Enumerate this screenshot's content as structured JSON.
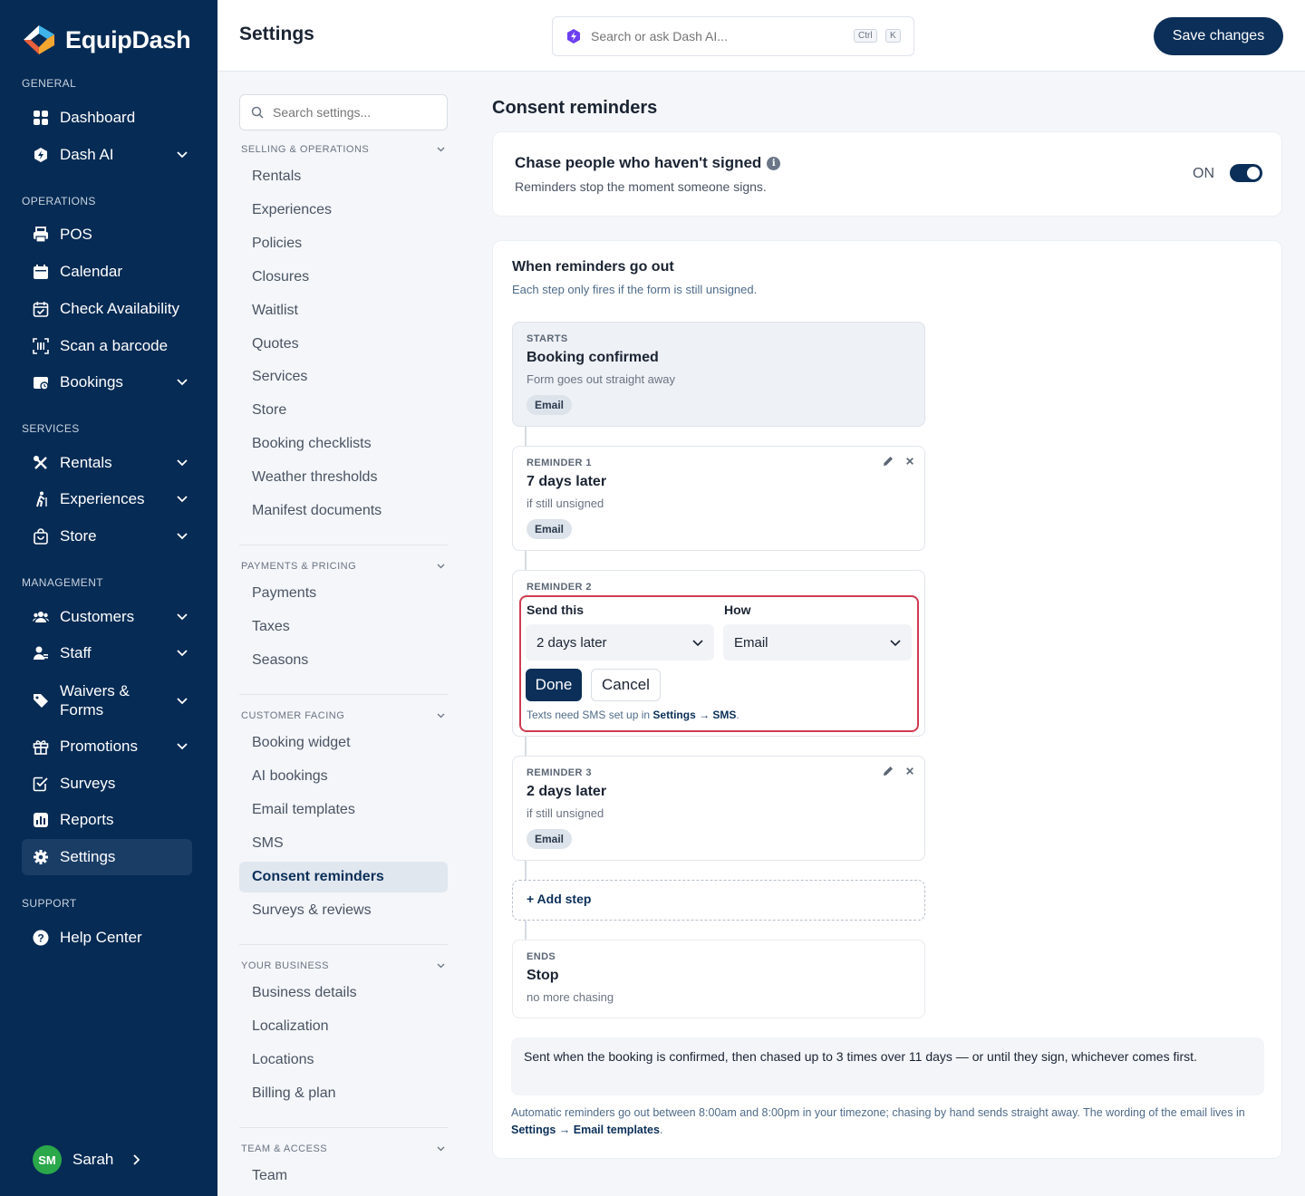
{
  "brand": {
    "name": "EquipDash",
    "accent": "#062b54"
  },
  "nav": {
    "sections": [
      {
        "label": "GENERAL",
        "items": [
          {
            "label": "Dashboard",
            "icon": "grid-icon",
            "chevron": false
          },
          {
            "label": "Dash AI",
            "icon": "sparkle-icon",
            "chevron": true
          }
        ]
      },
      {
        "label": "OPERATIONS",
        "items": [
          {
            "label": "POS",
            "icon": "printer-icon",
            "chevron": false
          },
          {
            "label": "Calendar",
            "icon": "calendar-icon",
            "chevron": false
          },
          {
            "label": "Check Availability",
            "icon": "calendar-check-icon",
            "chevron": false
          },
          {
            "label": "Scan a barcode",
            "icon": "barcode-icon",
            "chevron": false
          },
          {
            "label": "Bookings",
            "icon": "bookings-icon",
            "chevron": true
          }
        ]
      },
      {
        "label": "SERVICES",
        "items": [
          {
            "label": "Rentals",
            "icon": "tools-icon",
            "chevron": true
          },
          {
            "label": "Experiences",
            "icon": "hiker-icon",
            "chevron": true
          },
          {
            "label": "Store",
            "icon": "bag-icon",
            "chevron": true
          }
        ]
      },
      {
        "label": "MANAGEMENT",
        "items": [
          {
            "label": "Customers",
            "icon": "users-icon",
            "chevron": true
          },
          {
            "label": "Staff",
            "icon": "staff-icon",
            "chevron": true
          },
          {
            "label": "Waivers & Forms",
            "icon": "tag-icon",
            "chevron": true
          },
          {
            "label": "Promotions",
            "icon": "gift-icon",
            "chevron": true
          },
          {
            "label": "Surveys",
            "icon": "checkbox-icon",
            "chevron": false
          },
          {
            "label": "Reports",
            "icon": "chart-icon",
            "chevron": false
          },
          {
            "label": "Settings",
            "icon": "gear-icon",
            "chevron": false,
            "active": true
          }
        ]
      },
      {
        "label": "SUPPORT",
        "items": [
          {
            "label": "Help Center",
            "icon": "help-icon",
            "chevron": false
          }
        ]
      }
    ],
    "user": {
      "initials": "SM",
      "name": "Sarah"
    }
  },
  "header": {
    "title": "Settings",
    "search_placeholder": "Search or ask Dash AI...",
    "kbd_ctrl": "Ctrl",
    "kbd_k": "K",
    "save_label": "Save changes"
  },
  "subnav": {
    "search_placeholder": "Search settings...",
    "groups": [
      {
        "label": "SELLING & OPERATIONS",
        "items": [
          "Rentals",
          "Experiences",
          "Policies",
          "Closures",
          "Waitlist",
          "Quotes",
          "Services",
          "Store",
          "Booking checklists",
          "Weather thresholds",
          "Manifest documents"
        ]
      },
      {
        "label": "PAYMENTS & PRICING",
        "items": [
          "Payments",
          "Taxes",
          "Seasons"
        ]
      },
      {
        "label": "CUSTOMER FACING",
        "items": [
          "Booking widget",
          "AI bookings",
          "Email templates",
          "SMS",
          "Consent reminders",
          "Surveys & reviews"
        ],
        "active": "Consent reminders"
      },
      {
        "label": "YOUR BUSINESS",
        "items": [
          "Business details",
          "Localization",
          "Locations",
          "Billing & plan"
        ]
      },
      {
        "label": "TEAM & ACCESS",
        "items": [
          "Team"
        ]
      }
    ]
  },
  "main": {
    "section_title": "Consent reminders",
    "chase": {
      "title": "Chase people who haven't signed",
      "subtitle": "Reminders stop the moment someone signs.",
      "toggle_label": "ON",
      "toggle_on": true
    },
    "when": {
      "title": "When reminders go out",
      "subtitle": "Each step only fires if the form is still unsigned."
    },
    "steps": {
      "start": {
        "kicker": "STARTS",
        "title": "Booking confirmed",
        "desc": "Form goes out straight away",
        "chip": "Email"
      },
      "r1": {
        "kicker": "REMINDER 1",
        "title": "7 days later",
        "desc": "if still unsigned",
        "chip": "Email"
      },
      "r2": {
        "kicker": "REMINDER 2",
        "send_label": "Send this",
        "how_label": "How",
        "send_value": "2 days later",
        "how_value": "Email",
        "done_label": "Done",
        "cancel_label": "Cancel",
        "note_prefix": "Texts need SMS set up in ",
        "note_link": "Settings → SMS",
        "note_suffix": "."
      },
      "r3": {
        "kicker": "REMINDER 3",
        "title": "2 days later",
        "desc": "if still unsigned",
        "chip": "Email"
      },
      "add": {
        "label": "+ Add step"
      },
      "end": {
        "kicker": "ENDS",
        "title": "Stop",
        "desc": "no more chasing"
      }
    },
    "summary": "Sent when the booking is confirmed, then chased up to 3 times over 11 days — or until they sign, whichever comes first.",
    "footnote_prefix": "Automatic reminders go out between 8:00am and 8:00pm in your timezone; chasing by hand sends straight away. The wording of the email lives in ",
    "footnote_link": "Settings → Email templates",
    "footnote_suffix": "."
  }
}
